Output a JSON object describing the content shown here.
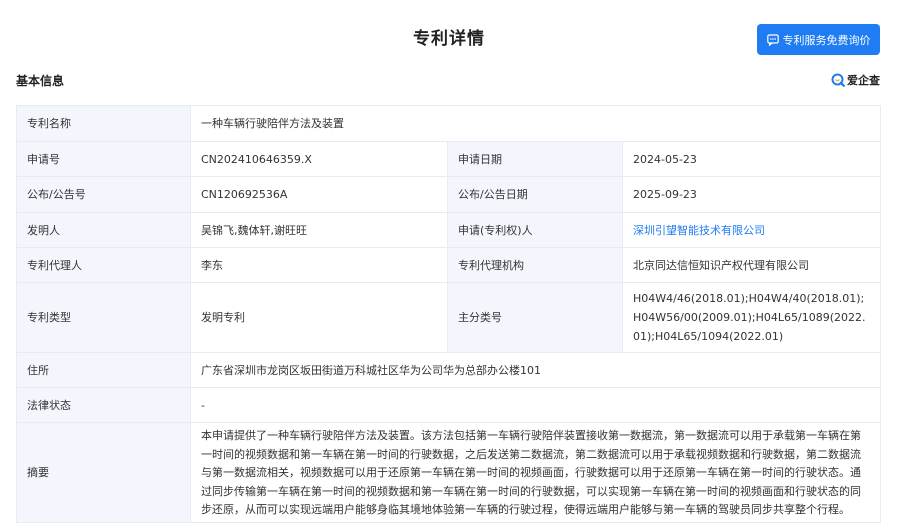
{
  "header": {
    "title": "专利详情",
    "consult_button": "专利服务免费询价"
  },
  "section": {
    "title": "基本信息",
    "brand": "爱企查"
  },
  "colors": {
    "primary": "#1f7cf2",
    "label_bg": "#f3f6fc",
    "border": "#e8ecf2"
  },
  "fields": {
    "name_label": "专利名称",
    "name_value": "一种车辆行驶陪伴方法及装置",
    "app_no_label": "申请号",
    "app_no_value": "CN202410646359.X",
    "app_date_label": "申请日期",
    "app_date_value": "2024-05-23",
    "pub_no_label": "公布/公告号",
    "pub_no_value": "CN120692536A",
    "pub_date_label": "公布/公告日期",
    "pub_date_value": "2025-09-23",
    "inventor_label": "发明人",
    "inventor_value": "吴锦飞,魏体轩,谢旺旺",
    "applicant_label": "申请(专利权)人",
    "applicant_value": "深圳引望智能技术有限公司",
    "agent_label": "专利代理人",
    "agent_value": "李东",
    "agency_label": "专利代理机构",
    "agency_value": "北京同达信恒知识产权代理有限公司",
    "type_label": "专利类型",
    "type_value": "发明专利",
    "class_label": "主分类号",
    "class_value": "H04W4/46(2018.01);H04W4/40(2018.01);H04W56/00(2009.01);H04L65/1089(2022.01);H04L65/1094(2022.01)",
    "address_label": "住所",
    "address_value": "广东省深圳市龙岗区坂田街道万科城社区华为公司华为总部办公楼101",
    "legal_label": "法律状态",
    "legal_value": "-",
    "abstract_label": "摘要",
    "abstract_value": "本申请提供了一种车辆行驶陪伴方法及装置。该方法包括第一车辆行驶陪伴装置接收第一数据流，第一数据流可以用于承载第一车辆在第一时间的视频数据和第一车辆在第一时间的行驶数据，之后发送第二数据流，第二数据流可以用于承载视频数据和行驶数据，第二数据流与第一数据流相关，视频数据可以用于还原第一车辆在第一时间的视频画面，行驶数据可以用于还原第一车辆在第一时间的行驶状态。通过同步传输第一车辆在第一时间的视频数据和第一车辆在第一时间的行驶数据，可以实现第一车辆在第一时间的视频画面和行驶状态的同步还原，从而可以实现远端用户能够身临其境地体验第一车辆的行驶过程，使得远端用户能够与第一车辆的驾驶员同步共享整个行程。"
  }
}
